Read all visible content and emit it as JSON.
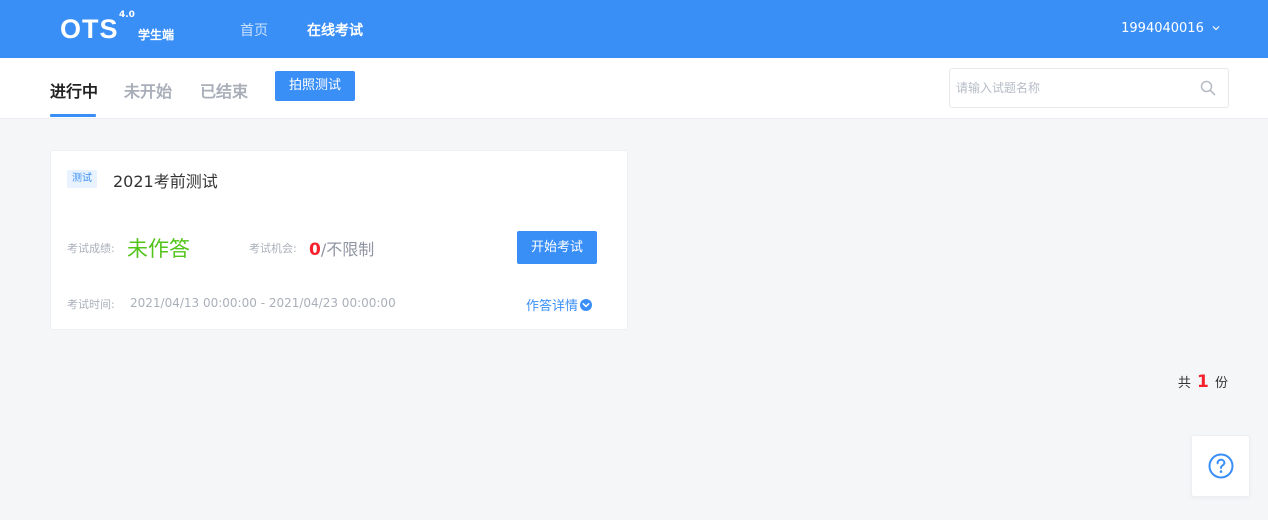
{
  "header": {
    "logo_text": "OTS",
    "logo_version": "4.0",
    "logo_subtitle": "学生端",
    "nav": [
      {
        "label": "首页"
      },
      {
        "label": "在线考试"
      }
    ],
    "username": "1994040016",
    "caret": "⌄"
  },
  "tabs": [
    {
      "label": "进行中",
      "active": true
    },
    {
      "label": "未开始",
      "active": false
    },
    {
      "label": "已结束",
      "active": false
    }
  ],
  "photo_test_button": "拍照测试",
  "search": {
    "placeholder": "请输入试题名称",
    "value": ""
  },
  "exam_card": {
    "type_tag": "测试",
    "title": "2021考前测试",
    "score_label": "考试成绩:",
    "score_value": "未作答",
    "chance_label": "考试机会:",
    "chance_used": "0",
    "chance_limit": "/不限制",
    "start_button": "开始考试",
    "time_label": "考试时间:",
    "time_value": "2021/04/13 00:00:00 - 2021/04/23 00:00:00",
    "detail_link": "作答详情"
  },
  "summary": {
    "prefix": "共",
    "count": "1",
    "suffix": "份"
  },
  "colors": {
    "primary": "#3a8ff7",
    "success": "#52c41a",
    "danger": "#f5222d"
  }
}
